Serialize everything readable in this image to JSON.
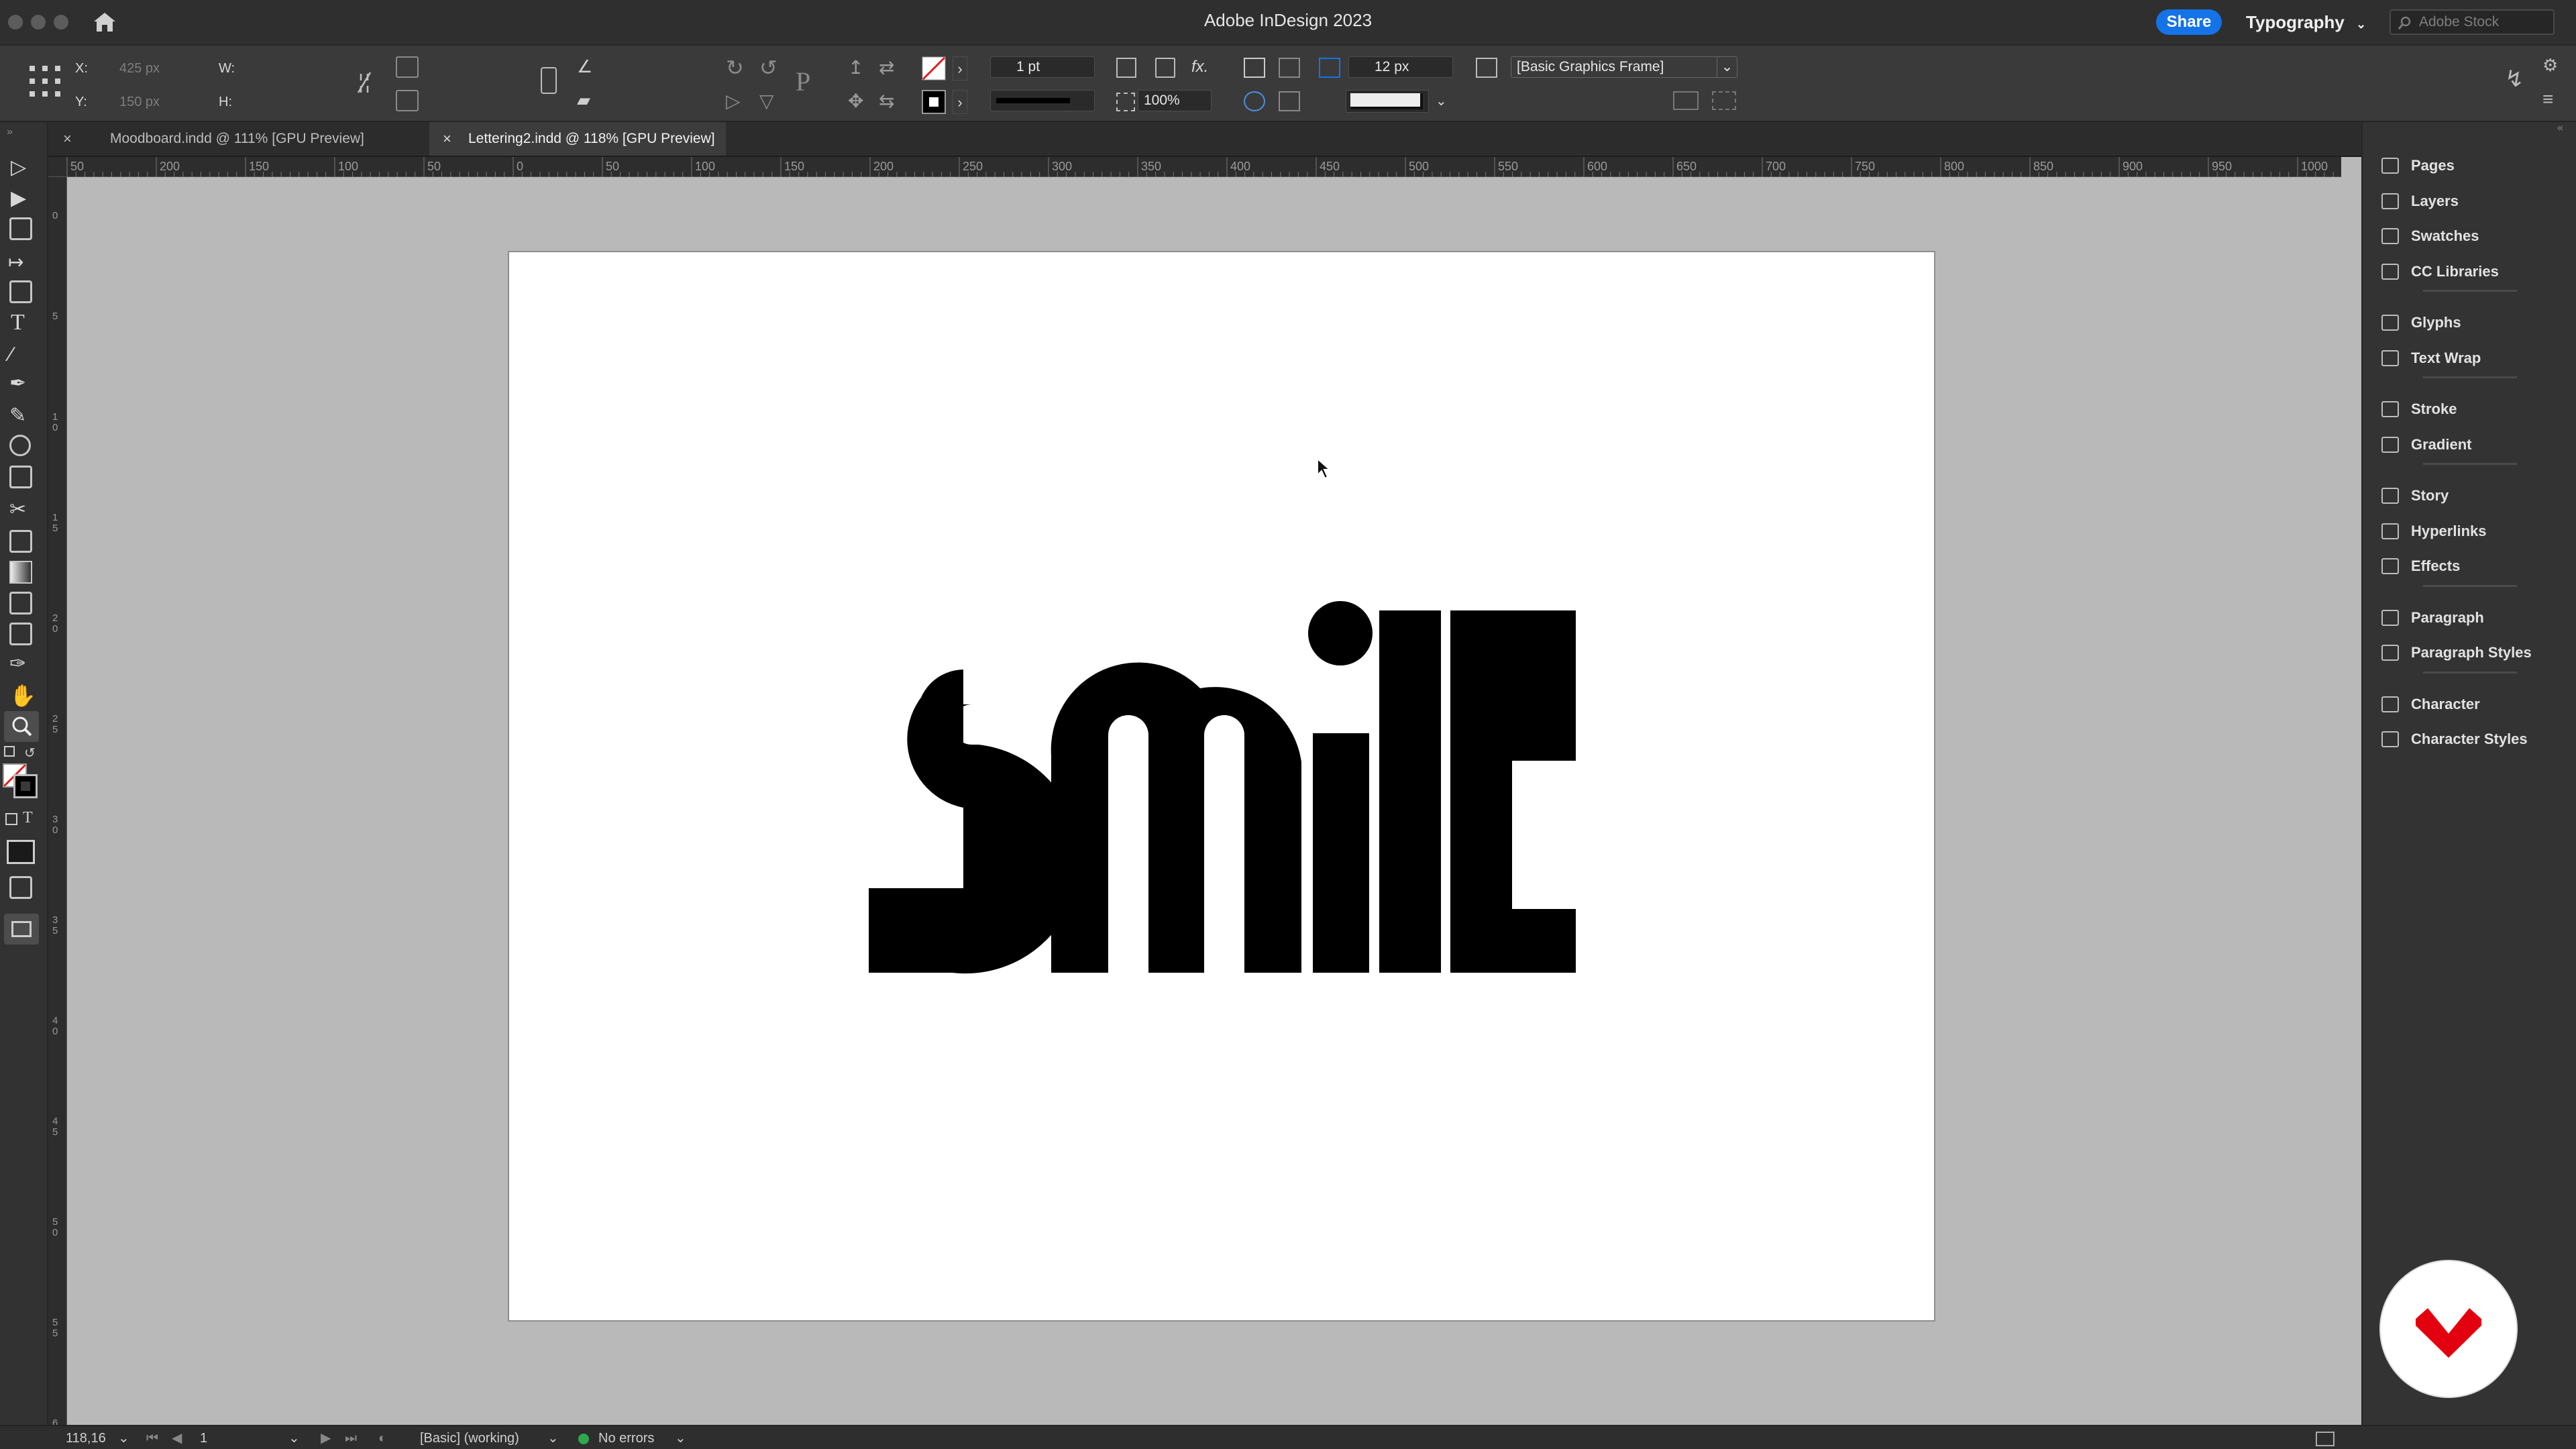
{
  "window": {
    "title": "Adobe InDesign 2023"
  },
  "titlebar": {
    "share_label": "Share",
    "workspace": "Typography",
    "stock_search_placeholder": "Adobe Stock"
  },
  "control": {
    "x_label": "X:",
    "x_value": "425 px",
    "y_label": "Y:",
    "y_value": "150 px",
    "w_label": "W:",
    "h_label": "H:",
    "stroke_weight": "1 pt",
    "opacity": "100%",
    "frame_fitting": "12 px",
    "object_style": "[Basic Graphics Frame]",
    "fx_label": "fx."
  },
  "tabs": [
    {
      "label": "Moodboard.indd @ 111% [GPU Preview]",
      "active": false
    },
    {
      "label": "Lettering2.indd @ 118% [GPU Preview]",
      "active": true
    }
  ],
  "ruler": {
    "top_labels": [
      "50",
      "200",
      "150",
      "100",
      "50",
      "0",
      "50",
      "100",
      "150",
      "200",
      "250",
      "300",
      "350",
      "400",
      "450",
      "500",
      "550",
      "600",
      "650",
      "700",
      "750",
      "800",
      "850",
      "900",
      "950",
      "1000"
    ],
    "left_labels": [
      "0",
      "5",
      "1\n0",
      "1\n5",
      "2\n0",
      "2\n5",
      "3\n0",
      "3\n5",
      "4\n0",
      "4\n5",
      "5\n0",
      "5\n5",
      "6"
    ]
  },
  "artwork": {
    "word": "SMILE",
    "fill": "#000000"
  },
  "panels": [
    {
      "label": "Pages",
      "icon": "pages-icon"
    },
    {
      "label": "Layers",
      "icon": "layers-icon"
    },
    {
      "label": "Swatches",
      "icon": "swatches-icon"
    },
    {
      "label": "CC Libraries",
      "icon": "cc-libraries-icon"
    },
    {
      "label": "Glyphs",
      "icon": "glyphs-icon"
    },
    {
      "label": "Text Wrap",
      "icon": "text-wrap-icon"
    },
    {
      "label": "Stroke",
      "icon": "stroke-icon"
    },
    {
      "label": "Gradient",
      "icon": "gradient-icon"
    },
    {
      "label": "Story",
      "icon": "story-icon"
    },
    {
      "label": "Hyperlinks",
      "icon": "hyperlinks-icon"
    },
    {
      "label": "Effects",
      "icon": "effects-icon"
    },
    {
      "label": "Paragraph",
      "icon": "paragraph-icon"
    },
    {
      "label": "Paragraph Styles",
      "icon": "paragraph-styles-icon"
    },
    {
      "label": "Character",
      "icon": "character-icon"
    },
    {
      "label": "Character Styles",
      "icon": "character-styles-icon"
    }
  ],
  "status": {
    "zoom": "118,16",
    "page": "1",
    "profile": "[Basic] (working)",
    "preflight": "No errors"
  },
  "colors": {
    "accent": "#1473e6",
    "brand_red": "#e3000f",
    "preflight_ok": "#2fa84f"
  }
}
